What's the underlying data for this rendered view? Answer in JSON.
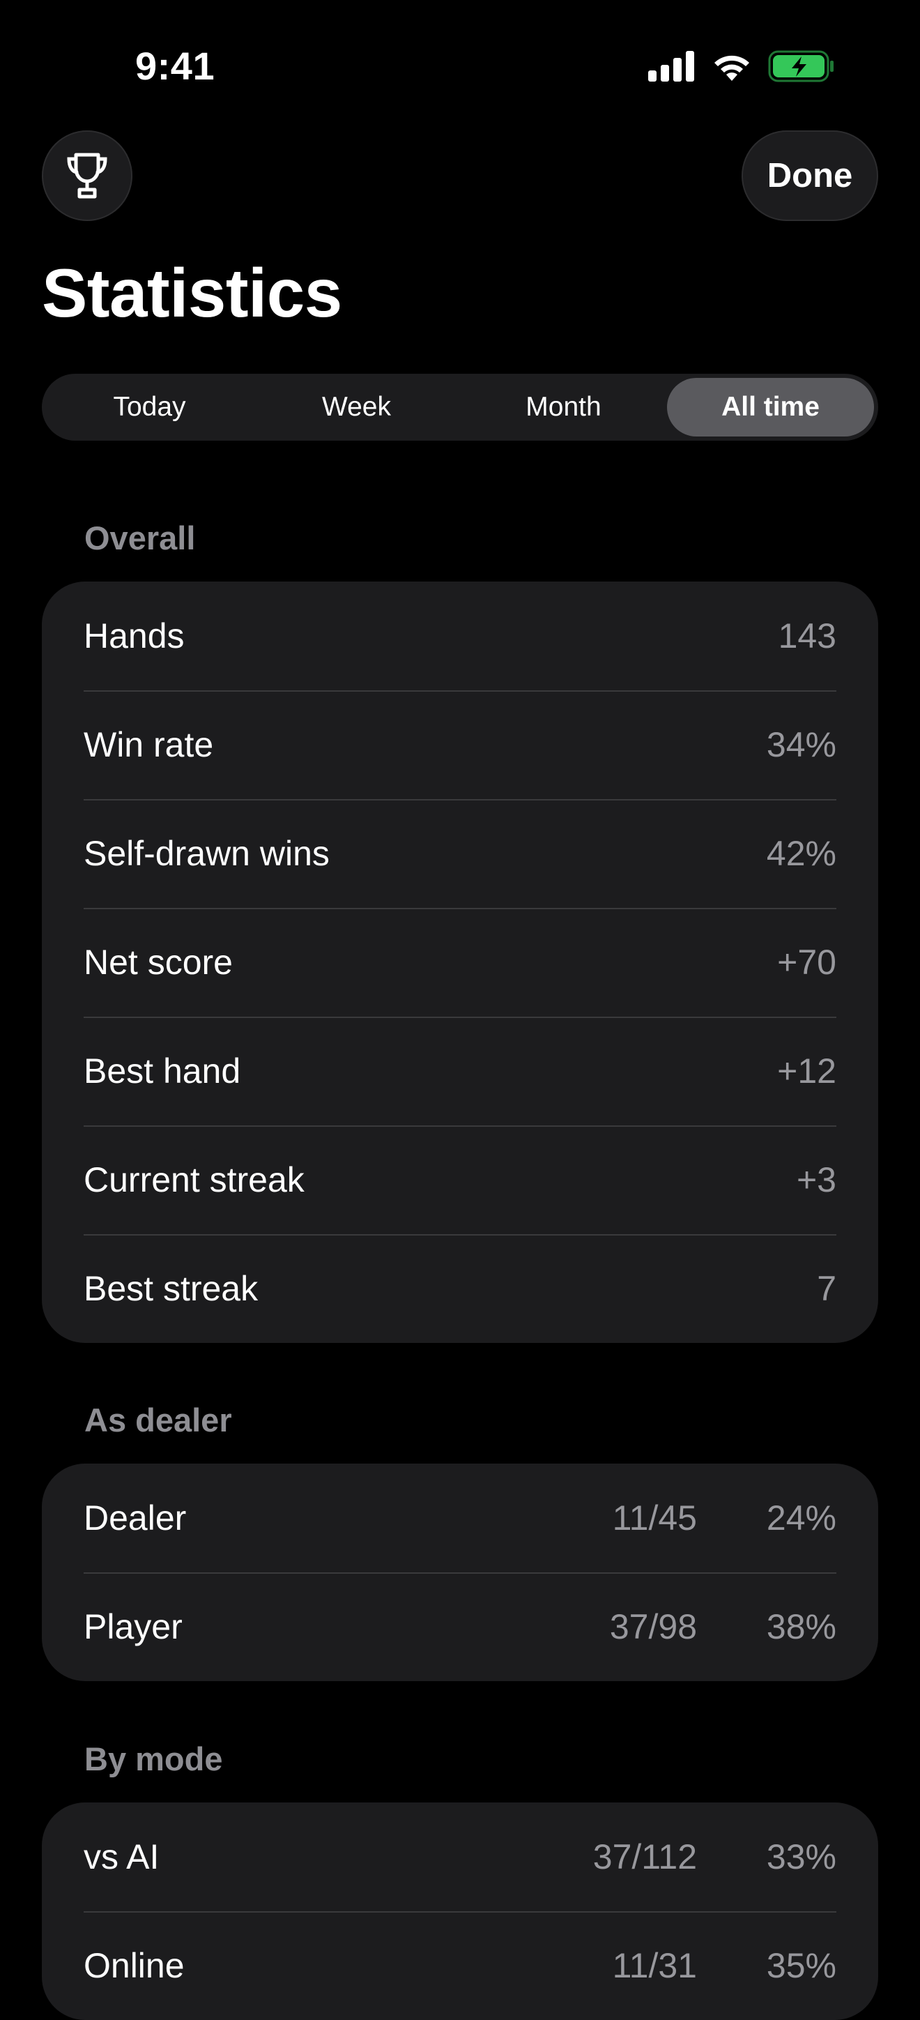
{
  "status_bar": {
    "time": "9:41",
    "icons": [
      "cellular-signal-icon",
      "wifi-icon",
      "battery-charging-icon"
    ],
    "battery_color": "#34c759"
  },
  "header": {
    "trophy_icon": "trophy-icon",
    "done_label": "Done",
    "title": "Statistics"
  },
  "segments": [
    {
      "label": "Today",
      "selected": false
    },
    {
      "label": "Week",
      "selected": false
    },
    {
      "label": "Month",
      "selected": false
    },
    {
      "label": "All time",
      "selected": true
    }
  ],
  "overall": {
    "header": "Overall",
    "rows": [
      {
        "label": "Hands",
        "value": "143"
      },
      {
        "label": "Win rate",
        "value": "34%"
      },
      {
        "label": "Self-drawn wins",
        "value": "42%"
      },
      {
        "label": "Net score",
        "value": "+70"
      },
      {
        "label": "Best hand",
        "value": "+12"
      },
      {
        "label": "Current streak",
        "value": "+3"
      },
      {
        "label": "Best streak",
        "value": "7"
      }
    ]
  },
  "as_dealer": {
    "header": "As dealer",
    "rows": [
      {
        "label": "Dealer",
        "count": "11/45",
        "rate": "24%"
      },
      {
        "label": "Player",
        "count": "37/98",
        "rate": "38%"
      }
    ]
  },
  "by_mode": {
    "header": "By mode",
    "rows": [
      {
        "label": "vs AI",
        "count": "37/112",
        "rate": "33%"
      },
      {
        "label": "Online",
        "count": "11/31",
        "rate": "35%"
      }
    ]
  }
}
